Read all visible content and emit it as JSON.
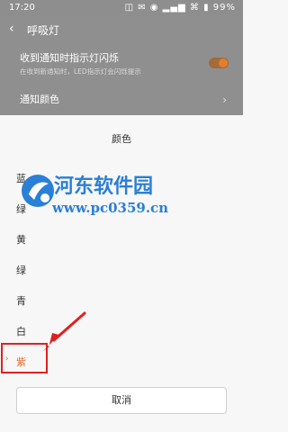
{
  "status_bar": {
    "time": "17:20",
    "icons": "◫ ✉ ◉ ▂▄▆ ⌘ ▮ 99%"
  },
  "settings": {
    "title": "呼吸灯",
    "blink_label": "收到通知时指示灯闪烁",
    "blink_desc": "在收到新通知时，LED指示灯会闪烁提示",
    "blink_enabled": true,
    "notification_color_label": "通知颜色"
  },
  "sheet": {
    "title": "颜色",
    "colors": [
      "蓝",
      "绿",
      "黄",
      "绿",
      "青",
      "白",
      "紫"
    ],
    "selected_index": 6,
    "cancel_label": "取消"
  },
  "watermark": {
    "title": "河东软件园",
    "url": "www.pc0359.cn"
  },
  "colors": {
    "accent": "#e6702c",
    "highlight": "#e02020",
    "watermark": "#2a7fd6"
  }
}
